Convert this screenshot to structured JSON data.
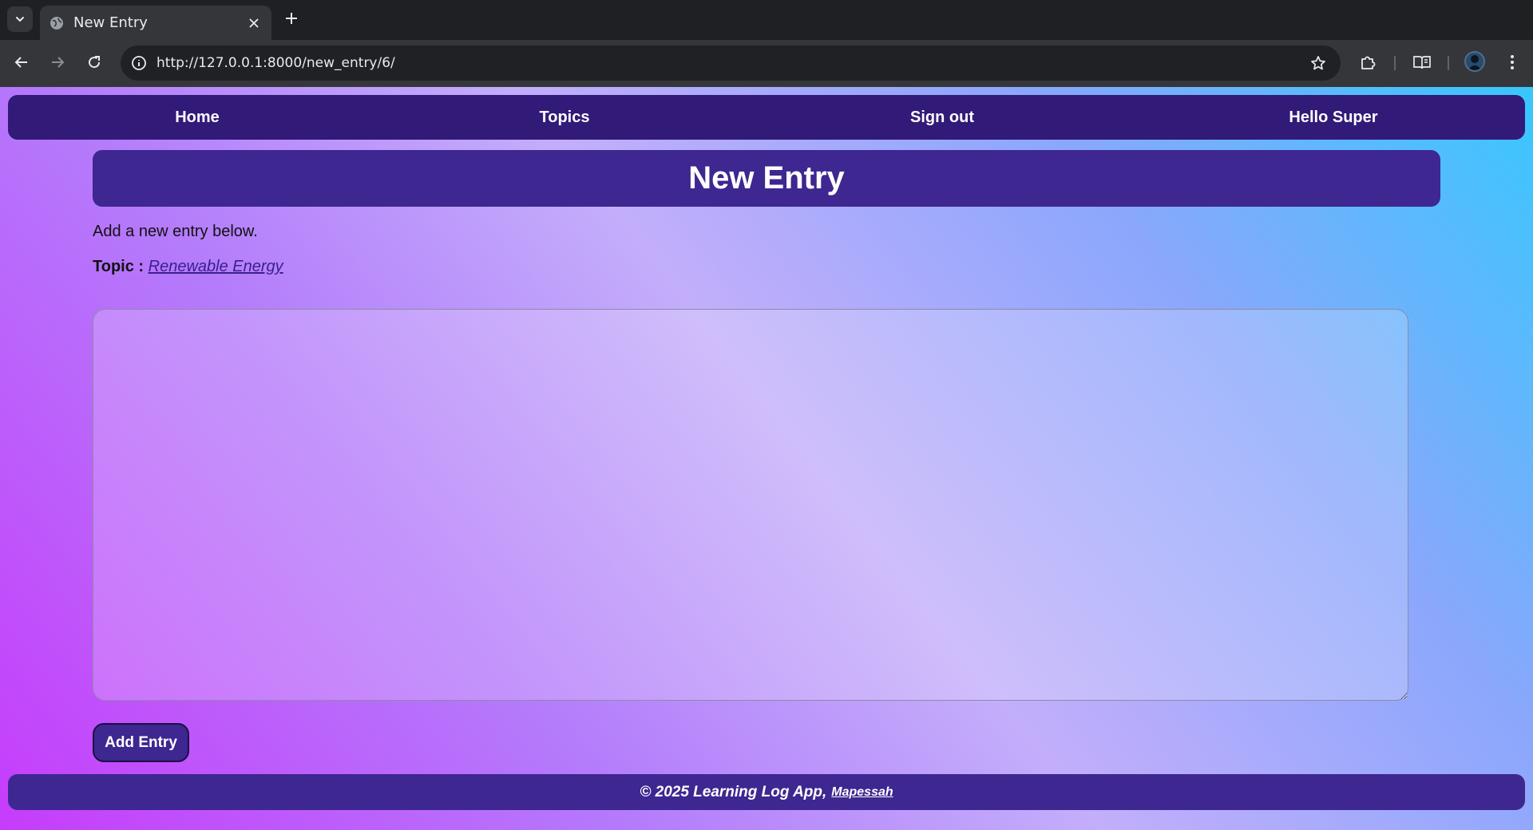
{
  "browser": {
    "tab_title": "New Entry",
    "url": "http://127.0.0.1:8000/new_entry/6/",
    "icons": {
      "tab_search": "chevron-down-icon",
      "favicon": "globe-icon",
      "close": "close-icon",
      "new_tab": "plus-icon",
      "back": "back-arrow-icon",
      "forward": "forward-arrow-icon",
      "reload": "reload-icon",
      "site_info": "info-icon",
      "bookmark": "star-icon",
      "extensions": "puzzle-icon",
      "reading_mode": "book-icon",
      "profile": "avatar",
      "menu": "kebab-menu-icon"
    }
  },
  "nav": {
    "home": "Home",
    "topics": "Topics",
    "sign_out": "Sign out",
    "greeting": "Hello Super"
  },
  "main": {
    "title": "New Entry",
    "intro": "Add a new entry below.",
    "topic_label": "Topic :",
    "topic_name": "Renewable Energy",
    "entry_text": "",
    "submit_label": "Add Entry"
  },
  "footer": {
    "text": "© 2025 Learning Log App,",
    "author": "Mapessah"
  },
  "colors": {
    "navbar": "#321a78",
    "card": "#3e2790",
    "gradient_start": "#c63cfb",
    "gradient_end": "#38c7fd"
  }
}
